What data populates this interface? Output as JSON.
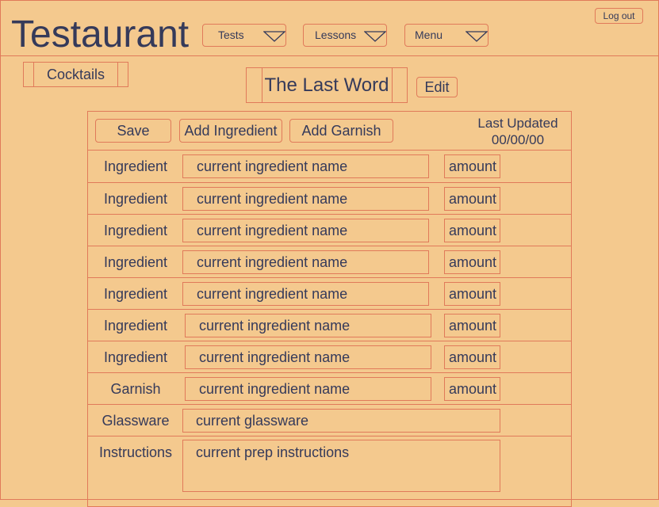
{
  "header": {
    "logo": "Testaurant",
    "menus": [
      {
        "label": "Tests"
      },
      {
        "label": "Lessons"
      },
      {
        "label": "Menu"
      }
    ],
    "logout_label": "Log out"
  },
  "breadcrumb": {
    "label": "Cocktails"
  },
  "recipe": {
    "title": "The Last Word",
    "edit_label": "Edit"
  },
  "toolbar": {
    "save_label": "Save",
    "add_ingredient_label": "Add Ingredient",
    "add_garnish_label": "Add Garnish",
    "last_updated_label": "Last Updated",
    "last_updated_value": "00/00/00"
  },
  "rows": [
    {
      "label": "Ingredient",
      "name": "current ingredient name",
      "amount": "amount"
    },
    {
      "label": "Ingredient",
      "name": "current ingredient name",
      "amount": "amount"
    },
    {
      "label": "Ingredient",
      "name": "current ingredient name",
      "amount": "amount"
    },
    {
      "label": "Ingredient",
      "name": "current ingredient name",
      "amount": "amount"
    },
    {
      "label": "Ingredient",
      "name": "current ingredient name",
      "amount": "amount"
    },
    {
      "label": "Ingredient",
      "name": "current ingredient name",
      "amount": "amount"
    },
    {
      "label": "Ingredient",
      "name": "current ingredient name",
      "amount": "amount"
    },
    {
      "label": "Garnish",
      "name": "current ingredient name",
      "amount": "amount"
    }
  ],
  "glassware": {
    "label": "Glassware",
    "value": "current glassware"
  },
  "instructions": {
    "label": "Instructions",
    "value": "current prep instructions"
  }
}
